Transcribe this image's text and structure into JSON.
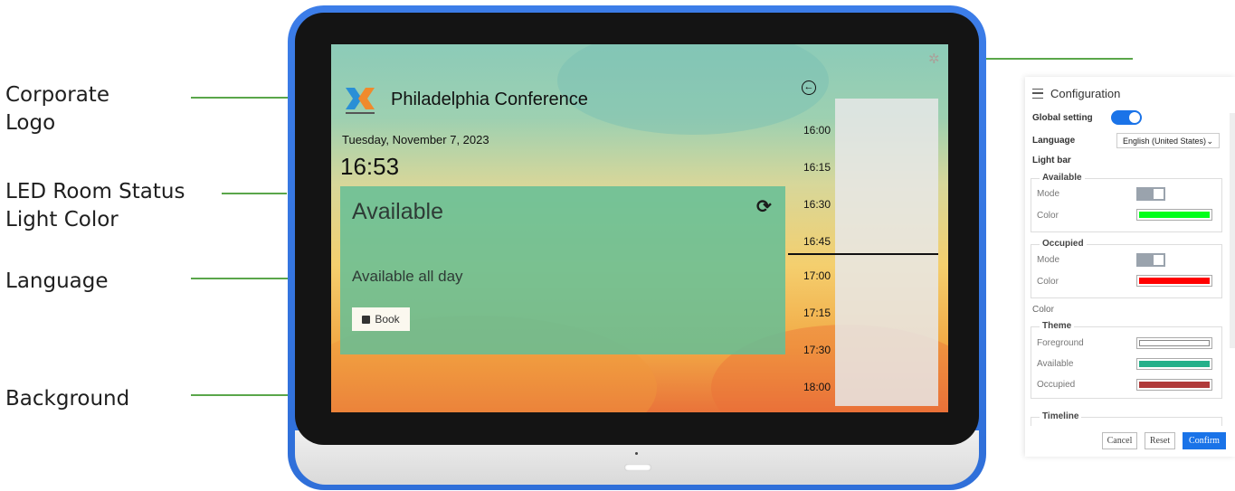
{
  "callouts": {
    "logo": "Corporate\nLogo",
    "led": "LED Room Status\nLight Color",
    "language": "Language",
    "background": "Background"
  },
  "screen": {
    "room_name": "Philadelphia Conference",
    "date": "Tuesday, November 7, 2023",
    "time": "16:53",
    "status": "Available",
    "status_detail": "Available all day",
    "book_label": "Book",
    "timeline": [
      "16:00",
      "16:15",
      "16:30",
      "16:45",
      "17:00",
      "17:15",
      "17:30",
      "18:00"
    ]
  },
  "colors": {
    "accent": "#1a73e8",
    "available_light": "#00ff1a",
    "occupied_light": "#ff0000",
    "theme_foreground": "#ffffff",
    "theme_available": "#25b08a",
    "theme_occupied": "#b03a3a"
  },
  "config": {
    "title": "Configuration",
    "global_setting": "Global setting",
    "language_label": "Language",
    "language_value": "English (United States)",
    "light_bar": "Light bar",
    "available_group": "Available",
    "occupied_group": "Occupied",
    "mode_label": "Mode",
    "color_label": "Color",
    "color_section": "Color",
    "theme_group": "Theme",
    "foreground_label": "Foreground",
    "available_label": "Available",
    "occupied_label": "Occupied",
    "timeline_group": "Timeline",
    "cancel": "Cancel",
    "reset": "Reset",
    "confirm": "Confirm"
  }
}
